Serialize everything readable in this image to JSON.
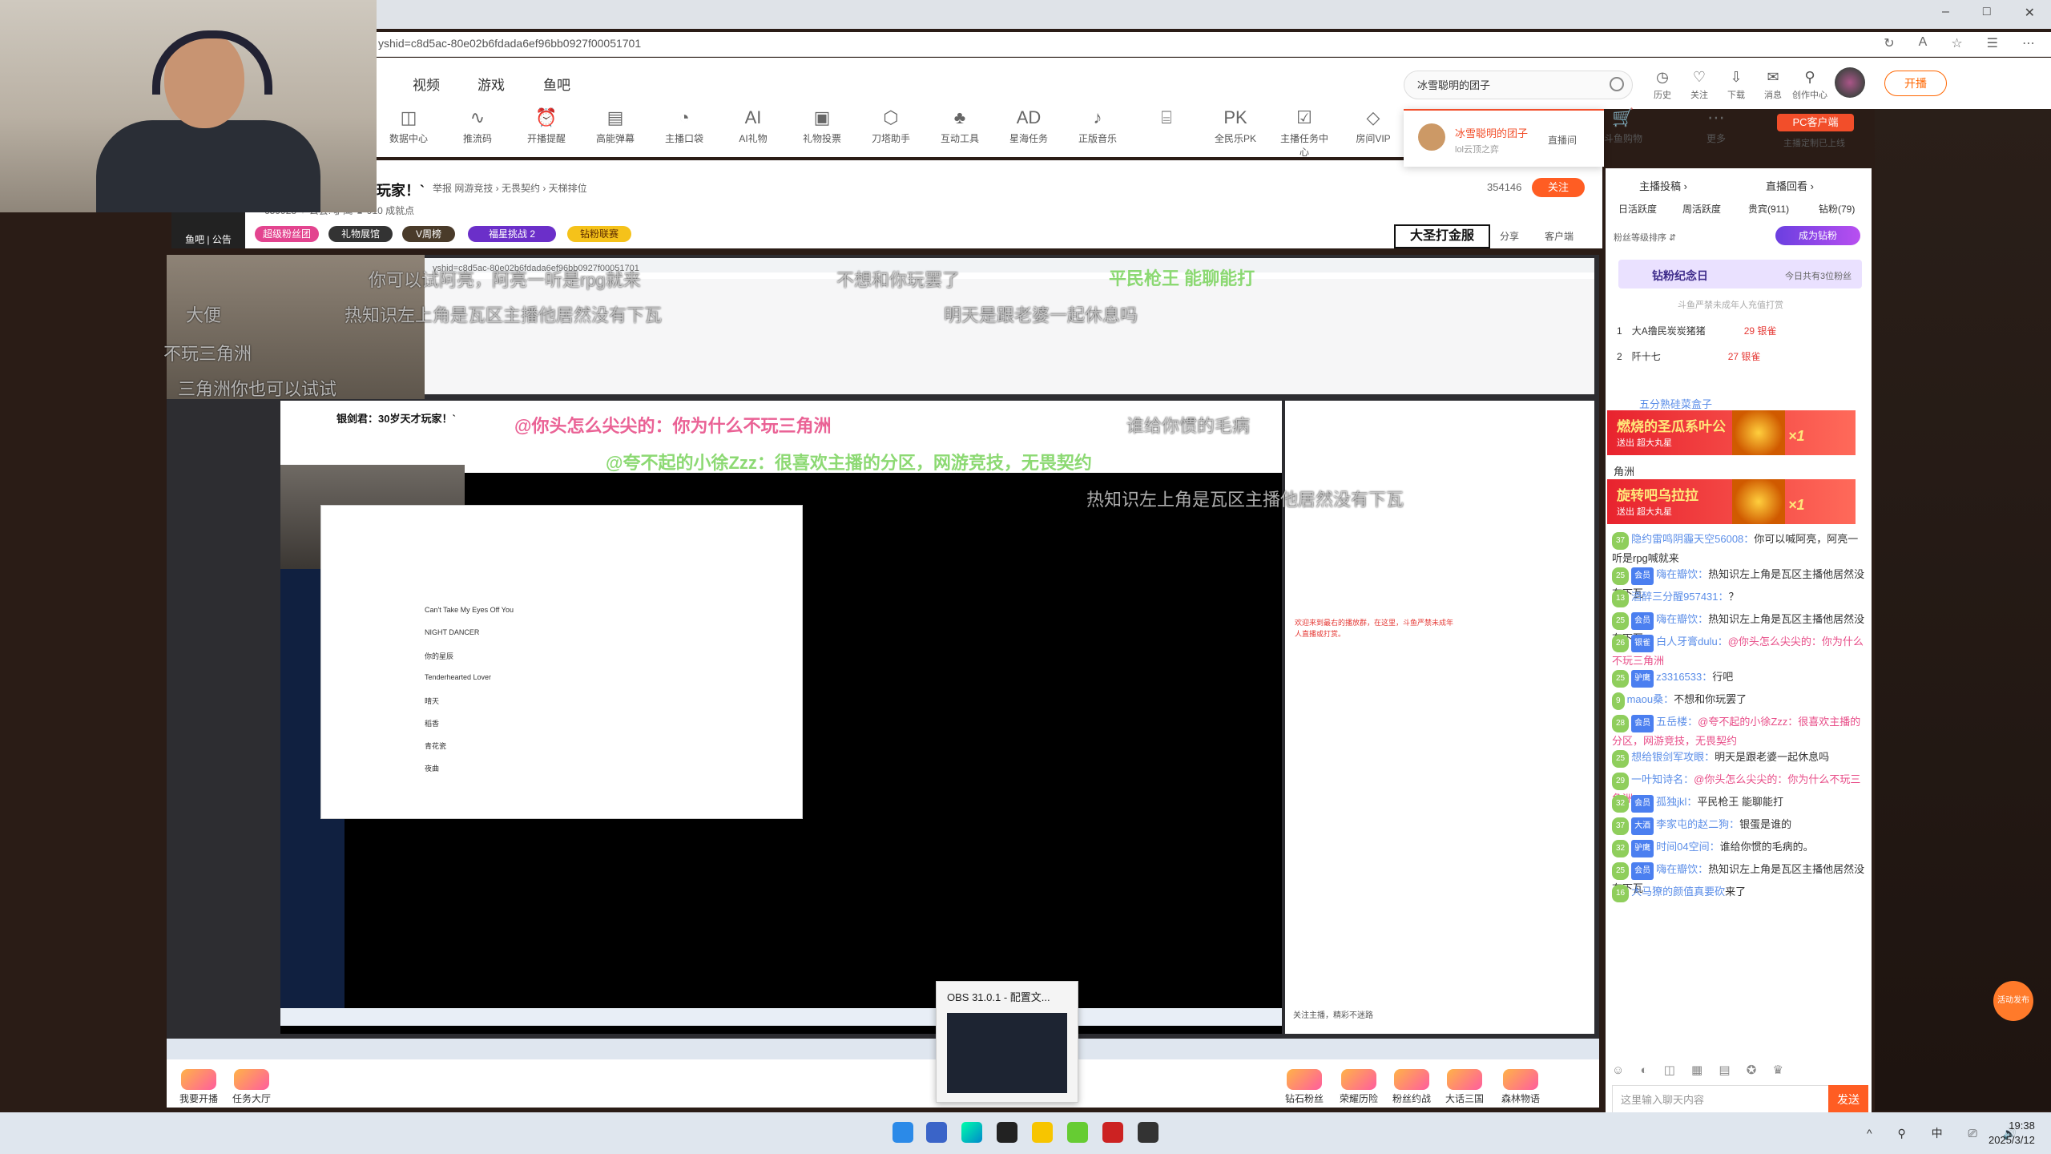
{
  "browser": {
    "url": "yshid=c8d5ac-80e02b6fdada6ef96bb0927f00051701",
    "win_min": "–",
    "win_max": "□",
    "win_close": "✕"
  },
  "header": {
    "nav": [
      "视频",
      "游戏",
      "鱼吧"
    ],
    "search_value": "冰雪聪明的团子",
    "icons": [
      {
        "label": "历史",
        "glyph": "◷"
      },
      {
        "label": "关注",
        "glyph": "♡"
      },
      {
        "label": "下载",
        "glyph": "⇩"
      },
      {
        "label": "消息",
        "glyph": "✉"
      },
      {
        "label": "创作中心",
        "glyph": "⚲"
      }
    ],
    "kaibo": "开播"
  },
  "toolbar": {
    "items": [
      {
        "label": "数据中心",
        "glyph": "◫"
      },
      {
        "label": "推流码",
        "glyph": "∿"
      },
      {
        "label": "开播提醒",
        "glyph": "⏰"
      },
      {
        "label": "高能弹幕",
        "glyph": "▤"
      },
      {
        "label": "主播口袋",
        "glyph": "◔"
      },
      {
        "label": "AI礼物",
        "glyph": "AI"
      },
      {
        "label": "礼物投票",
        "glyph": "▣"
      },
      {
        "label": "刀塔助手",
        "glyph": "⬡"
      },
      {
        "label": "互动工具",
        "glyph": "♣"
      },
      {
        "label": "星海任务",
        "glyph": "AD"
      },
      {
        "label": "正版音乐",
        "glyph": "♪"
      },
      {
        "label": "",
        "glyph": "⌸"
      },
      {
        "label": "全民乐PK",
        "glyph": "PK"
      },
      {
        "label": "主播任务中心",
        "glyph": "☑"
      },
      {
        "label": "房间VIP",
        "glyph": "◇"
      }
    ],
    "right_items": [
      {
        "label": "斗鱼购物",
        "glyph": "🛒"
      },
      {
        "label": "更多",
        "glyph": "⋯"
      }
    ],
    "pc_client": "PC客户端",
    "pc_client_sub": "主播定制已上线"
  },
  "search_dropdown": {
    "name": "冰雪聪明的团子",
    "sub": "lol云顶之弈",
    "live": "直播间"
  },
  "room": {
    "title": "玩家！`",
    "meta": "举报   网游竞技 › 无畏契约 › 天梯排位",
    "fans": "659928   ♀ 公会: 驴鹰   ♛ 910 成就点",
    "follow_count": "354146",
    "follow": "关注",
    "fish_tag": "鱼吧 | 公告",
    "badges": [
      "超级粉丝团",
      "礼物展馆",
      "V周榜",
      "福星挑战 2",
      "钻粉联赛"
    ],
    "dsb": "大圣打金服",
    "share": "分享",
    "client": "客户端"
  },
  "danmu": {
    "lines": [
      "你可以试阿亮，阿亮一听是rpg就来",
      "不想和你玩罢了",
      "大便",
      "热知识左上角是瓦区主播他居然没有下瓦",
      "明天是跟老婆一起休息吗",
      "不玩三角洲",
      "三角洲你也可以试试",
      "谁给你惯的毛病",
      "热知识左上角是瓦区主播他居然没有下瓦"
    ],
    "green_line": "平民枪王 能聊能打",
    "pink_line": "@你头怎么尖尖的：你为什么不玩三角洲",
    "green_line2": "@夸不起的小徐Zzz：很喜欢主播的分区，网游竞技，无畏契约"
  },
  "nested": {
    "addr": "yshid=c8d5ac-80e02b6fdada6ef96bb0927f00051701",
    "title": "银剑君：30岁天才玩家！`",
    "songs": [
      "Can't Take My Eyes Off You",
      "NIGHT DANCER",
      "你的星辰",
      "Tenderhearted Lover",
      "晴天",
      "稻香",
      "青花瓷",
      "夜曲"
    ],
    "notice": "欢迎来到最右的播放群，在这里，斗鱼严禁未成年人直播或打赏。",
    "follow_msg": "关注主播，精彩不迷路"
  },
  "chat": {
    "tabs": [
      "主播投稿 ›",
      "直播回看 ›"
    ],
    "sub_tabs": [
      "日活跃度",
      "周活跃度",
      "贵宾(911)",
      "钻粉(79)"
    ],
    "fans_row": "粉丝等级排序 ⇵",
    "become_fans": "成为钻粉",
    "anniv_title": "钻粉纪念日",
    "anniv_count": "今日共有3位粉丝",
    "anniv_note": "斗鱼严禁未成年人充值打赏",
    "rank": [
      {
        "no": "1",
        "name": "大A撸民炭炭猪猪",
        "badge": "29 银雀"
      },
      {
        "no": "2",
        "name": "阡十七",
        "badge": "27 银雀"
      }
    ],
    "gifts": [
      {
        "title": "燃烧的圣瓜系叶公",
        "from": "送出 超大丸星",
        "count": "×1"
      },
      {
        "title": "旋转吧乌拉拉",
        "from": "送出 超大丸星",
        "count": "×1"
      }
    ],
    "gift_note_top": "五分熟硅菜盒子",
    "gift_note_mid": "角洲",
    "messages": [
      {
        "lvl": "37",
        "tag": "",
        "nick": "隐约雷鸣阴霾天空56008：",
        "text": "你可以喊阿亮，阿亮一听是rpg喊就来"
      },
      {
        "lvl": "25",
        "tag": "会员",
        "nick": "嗨在瓣饮：",
        "text": "热知识左上角是瓦区主播他居然没有下瓦"
      },
      {
        "lvl": "13",
        "tag": "",
        "nick": "酒醉三分醒957431：",
        "text": "？"
      },
      {
        "lvl": "25",
        "tag": "会员",
        "nick": "嗨在瓣饮：",
        "text": "热知识左上角是瓦区主播他居然没有下瓦"
      },
      {
        "lvl": "26",
        "tag": "银雀",
        "nick": "白人牙膏dulu：",
        "text": "@你头怎么尖尖的：你为什么不玩三角洲"
      },
      {
        "lvl": "25",
        "tag": "驴鹰",
        "nick": "z3316533：",
        "text": "行吧"
      },
      {
        "lvl": "9",
        "tag": "",
        "nick": "maou桑：",
        "text": "不想和你玩罢了"
      },
      {
        "lvl": "28",
        "tag": "会员",
        "nick": "五岳楼：",
        "text": "@夸不起的小徐Zzz：很喜欢主播的分区，网游竞技，无畏契约"
      },
      {
        "lvl": "25",
        "tag": "",
        "nick": "想给银剑军攻眼：",
        "text": "明天是跟老婆一起休息吗"
      },
      {
        "lvl": "29",
        "tag": "",
        "nick": "一叶知诗名：",
        "text": "@你头怎么尖尖的：你为什么不玩三角洲"
      },
      {
        "lvl": "32",
        "tag": "会员",
        "nick": "孤独jkl：",
        "text": "平民枪王 能聊能打"
      },
      {
        "lvl": "37",
        "tag": "大酒",
        "nick": "李家屯的赵二狗：",
        "text": "银蛋是谁的"
      },
      {
        "lvl": "32",
        "tag": "驴鹰",
        "nick": "时间04空间：",
        "text": "谁给你惯的毛病的。"
      },
      {
        "lvl": "25",
        "tag": "会员",
        "nick": "嗨在瓣饮：",
        "text": "热知识左上角是瓦区主播他居然没有下瓦"
      },
      {
        "lvl": "16",
        "tag": "",
        "nick": "大马獠的颜值真要砍",
        "text": "来了"
      }
    ],
    "input_placeholder": "这里输入聊天内容",
    "send": "发送",
    "input_icons": "☺ ◐ ◫ ▦ ▤ ✪ ♛"
  },
  "assist": "活动发布",
  "bottom_acts": [
    {
      "label": "我要开播"
    },
    {
      "label": "任务大厅"
    },
    {
      "label": "钻石粉丝"
    },
    {
      "label": "荣耀历险"
    },
    {
      "label": "粉丝约战"
    },
    {
      "label": "大话三国"
    },
    {
      "label": "森林物语"
    }
  ],
  "obs": {
    "title": "OBS 31.0.1 - 配置文..."
  },
  "taskbar": {
    "time": "19:38",
    "date": "2025/3/12",
    "tray": "^ ⚲ 中 ⎚ 🔊"
  }
}
